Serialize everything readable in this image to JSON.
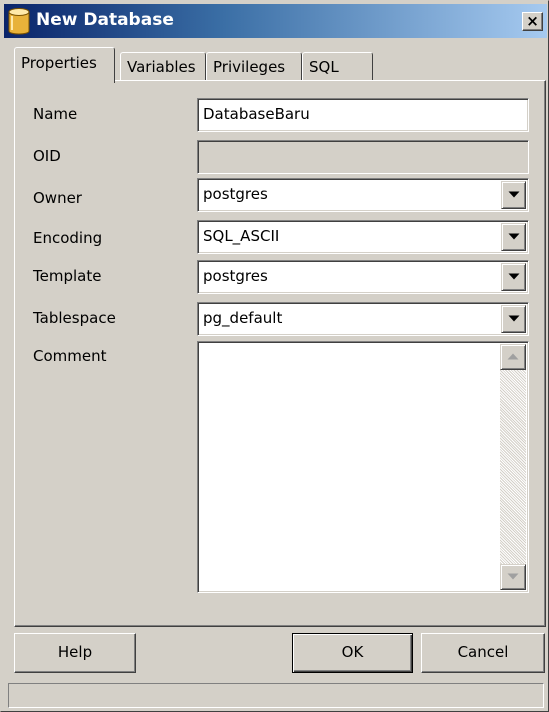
{
  "window": {
    "title": "New Database",
    "close_label": "×"
  },
  "tabs": [
    {
      "label": "Properties",
      "active": true
    },
    {
      "label": "Variables",
      "active": false
    },
    {
      "label": "Privileges",
      "active": false
    },
    {
      "label": "SQL",
      "active": false
    }
  ],
  "form": {
    "name": {
      "label": "Name",
      "value": "DatabaseBaru"
    },
    "oid": {
      "label": "OID",
      "value": ""
    },
    "owner": {
      "label": "Owner",
      "value": "postgres"
    },
    "encoding": {
      "label": "Encoding",
      "value": "SQL_ASCII"
    },
    "template": {
      "label": "Template",
      "value": "postgres"
    },
    "tablespace": {
      "label": "Tablespace",
      "value": "pg_default"
    },
    "comment": {
      "label": "Comment",
      "value": ""
    }
  },
  "buttons": {
    "help": "Help",
    "ok": "OK",
    "cancel": "Cancel"
  },
  "status": {
    "text": ""
  },
  "icons": {
    "title": "database-icon",
    "dropdown": "chevron-down-icon",
    "scroll_up": "scroll-up-arrow-icon",
    "scroll_down": "scroll-down-arrow-icon"
  },
  "colors": {
    "titlebar_start": "#0a246a",
    "titlebar_end": "#a6caf0",
    "face": "#d4d0c8"
  }
}
